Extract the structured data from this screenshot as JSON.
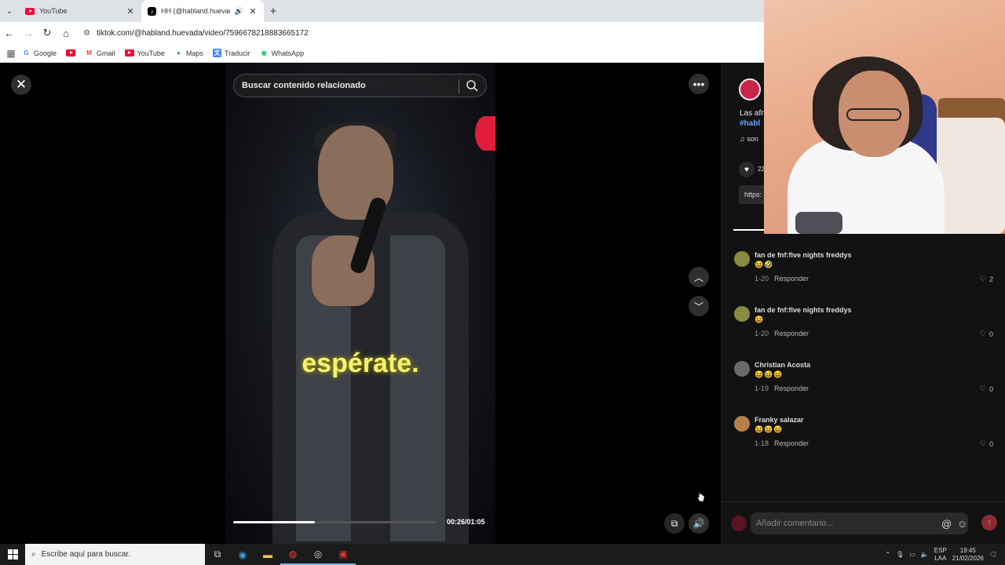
{
  "browser": {
    "tabs": [
      {
        "title": "YouTube",
        "favicon": "youtube-icon"
      },
      {
        "title": "HH (@habland.huevada) | T",
        "favicon": "tiktok-icon"
      }
    ],
    "url": "tiktok.com/@habland.huevada/video/7596678218883665172",
    "bookmarks": [
      "Google",
      "Gmail",
      "YouTube",
      "Maps",
      "Traducir",
      "WhatsApp"
    ]
  },
  "video": {
    "search_placeholder": "Buscar contenido relacionado",
    "caption": "espérate.",
    "time": "00:26/01:05",
    "progress": 0.4
  },
  "side": {
    "desc_line1": "Las afr",
    "desc_tag": "#habl",
    "music": "son",
    "like_count": "22",
    "link_text": "https:",
    "comments": [
      {
        "name": "fan de fnf:five nights freddys",
        "emoji": "😆🤣",
        "date": "1-20",
        "reply": "Responder",
        "likes": "2"
      },
      {
        "name": "fan de fnf:five nights freddys",
        "emoji": "😆",
        "date": "1-20",
        "reply": "Responder",
        "likes": "0"
      },
      {
        "name": "Christian Acosta",
        "emoji": "😆😆😆",
        "date": "1-19",
        "reply": "Responder",
        "likes": "0"
      },
      {
        "name": "Franky salazar",
        "emoji": "😆😆😆",
        "date": "1-18",
        "reply": "Responder",
        "likes": "0"
      }
    ],
    "comment_placeholder": "Añadir comentario..."
  },
  "taskbar": {
    "search_placeholder": "Escribe aquí para buscar.",
    "lang_top": "ESP",
    "lang_bottom": "LAA",
    "time": "19:45",
    "date": "21/02/2026"
  },
  "colors": {
    "accent_link": "#6ba6ff",
    "youtube_red": "#ff0033",
    "caption_yellow": "#f4f176"
  }
}
